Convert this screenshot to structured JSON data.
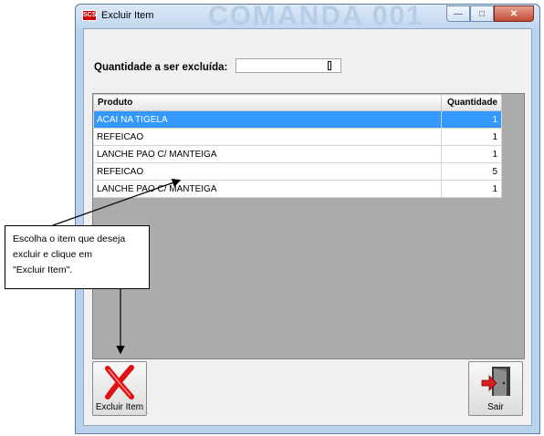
{
  "window": {
    "title": "Excluir Item",
    "background_title": "COMANDA 001",
    "app_icon_text": "SCS"
  },
  "form": {
    "quantity_label": "Quantidade a ser excluída:",
    "quantity_value": ""
  },
  "grid": {
    "columns": [
      "Produto",
      "Quantidade"
    ],
    "rows": [
      {
        "produto": "ACAI NA TIGELA",
        "quantidade": "1",
        "selected": true
      },
      {
        "produto": "REFEICAO",
        "quantidade": "1",
        "selected": false
      },
      {
        "produto": "LANCHE PAO C/ MANTEIGA",
        "quantidade": "1",
        "selected": false
      },
      {
        "produto": "REFEICAO",
        "quantidade": "5",
        "selected": false
      },
      {
        "produto": "LANCHE PAO C/ MANTEIGA",
        "quantidade": "1",
        "selected": false
      }
    ]
  },
  "buttons": {
    "excluir_label": "Excluir Item",
    "sair_label": "Sair"
  },
  "callout": {
    "lines": [
      "Escolha o item que deseja",
      "excluir e clique em",
      "\"Excluir Item\"."
    ]
  },
  "colors": {
    "selection": "#3399ff",
    "window_frame": "#b9d1ea"
  }
}
